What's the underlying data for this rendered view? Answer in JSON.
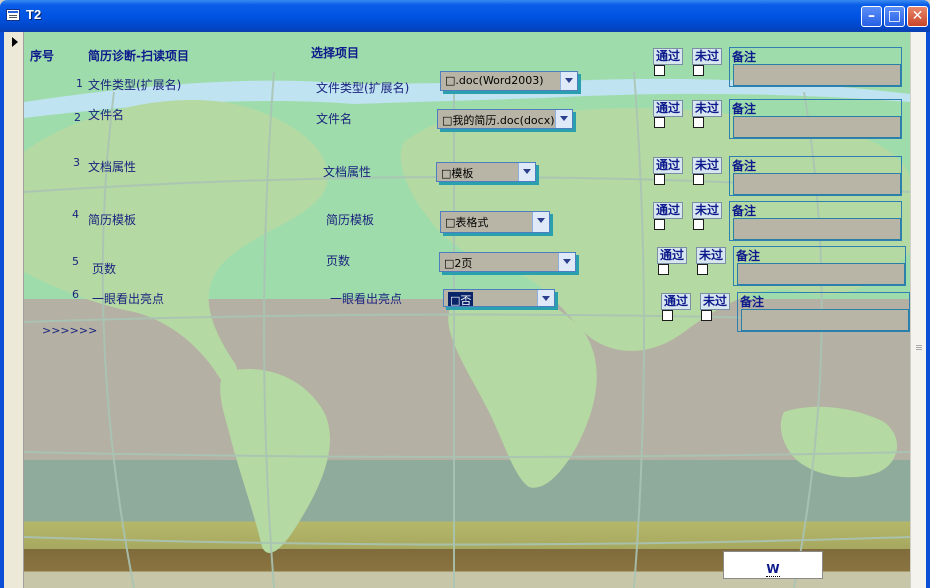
{
  "window": {
    "title": "T2"
  },
  "headers": {
    "seq": "序号",
    "diagnosis": "简历诊断-扫读项目",
    "select": "选择项目"
  },
  "rows": [
    {
      "num": "1",
      "item": "文件类型(扩展名)",
      "select_label": "文件类型(扩展名)",
      "value": "□.doc(Word2003)",
      "pass": "通过",
      "fail": "未过",
      "note": "备注"
    },
    {
      "num": "2",
      "item": "文件名",
      "select_label": "文件名",
      "value": "□我的简历.doc(docx)",
      "pass": "通过",
      "fail": "未过",
      "note": "备注"
    },
    {
      "num": "3",
      "item": "文档属性",
      "select_label": "文档属性",
      "value": "□模板",
      "pass": "通过",
      "fail": "未过",
      "note": "备注"
    },
    {
      "num": "4",
      "item": "简历模板",
      "select_label": "简历模板",
      "value": "□表格式",
      "pass": "通过",
      "fail": "未过",
      "note": "备注"
    },
    {
      "num": "5",
      "item": "页数",
      "select_label": "页数",
      "value": "□2页",
      "pass": "通过",
      "fail": "未过",
      "note": "备注"
    },
    {
      "num": "6",
      "item": "一眼看出亮点",
      "select_label": "一眼看出亮点",
      "value": "□否",
      "pass": "通过",
      "fail": "未过",
      "note": "备注"
    }
  ],
  "next_link": ">>>>>>",
  "bottom_button": "W",
  "colors": {
    "map_green": "#9fdcab",
    "ocean_gray": "#b4b0a3",
    "label_blue": "#1a237e",
    "field_gray": "#b8b4a6"
  }
}
